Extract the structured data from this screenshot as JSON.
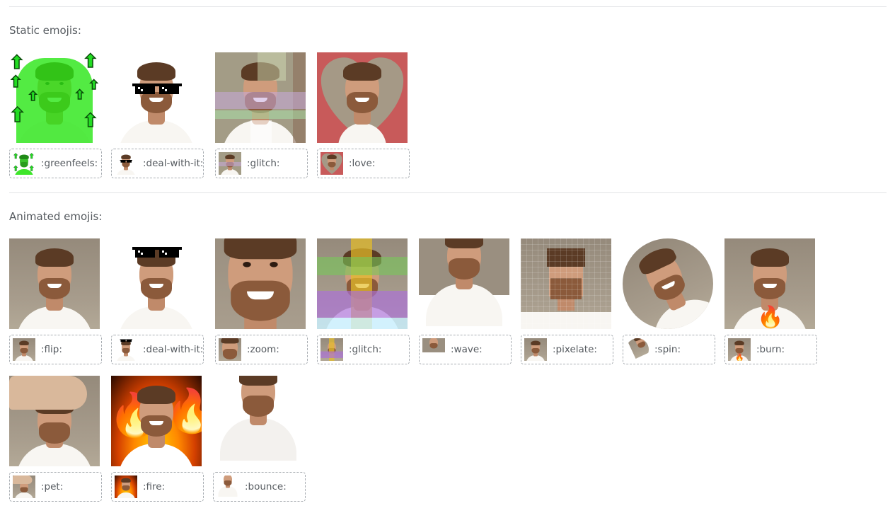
{
  "sections": {
    "static_title": "Static emojis:",
    "animated_title": "Animated emojis:"
  },
  "static_emojis": [
    {
      "code": ":greenfeels:"
    },
    {
      "code": ":deal-with-it:"
    },
    {
      "code": ":glitch:"
    },
    {
      "code": ":love:"
    }
  ],
  "animated_emojis": [
    {
      "code": ":flip:"
    },
    {
      "code": ":deal-with-it:"
    },
    {
      "code": ":zoom:"
    },
    {
      "code": ":glitch:"
    },
    {
      "code": ":wave:"
    },
    {
      "code": ":pixelate:"
    },
    {
      "code": ":spin:"
    },
    {
      "code": ":burn:"
    },
    {
      "code": ":pet:"
    },
    {
      "code": ":fire:"
    },
    {
      "code": ":bounce:"
    }
  ],
  "colors": {
    "green_tint": "#28e614",
    "love_bg": "#c85a5a",
    "divider": "#e2e4e6",
    "label_border": "#a8adb2"
  }
}
